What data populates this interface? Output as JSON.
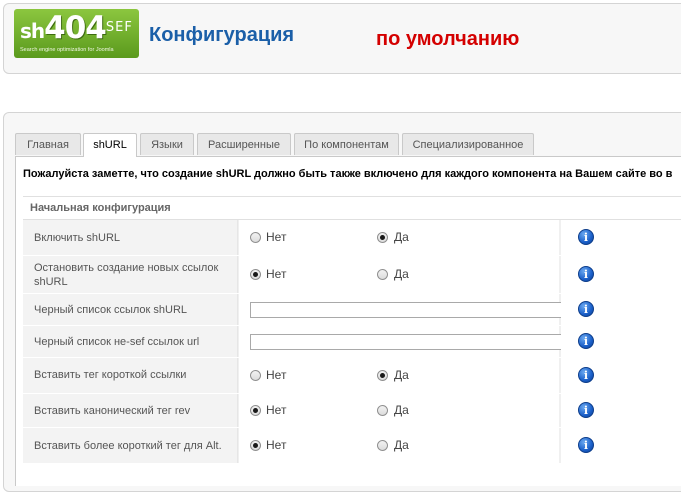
{
  "header": {
    "logo_sh": "sh",
    "logo_num": "404",
    "logo_sef": "SEF",
    "logo_tagline": "Search engine optimization for Joomla",
    "title": "Конфигурация",
    "default_label": "по умолчанию"
  },
  "tabs": [
    {
      "label": "Главная",
      "active": false
    },
    {
      "label": "shURL",
      "active": true
    },
    {
      "label": "Языки",
      "active": false
    },
    {
      "label": "Расширенные",
      "active": false
    },
    {
      "label": "По компонентам",
      "active": false
    },
    {
      "label": "Специализированное",
      "active": false
    }
  ],
  "notice": "Пожалуйста заметте, что создание shURL должно быть также включено для каждого компонента на Вашем сайте во в",
  "section_title": "Начальная конфигурация",
  "options": {
    "no": "Нет",
    "yes": "Да"
  },
  "rows": [
    {
      "label": "Включить shURL",
      "type": "radio",
      "value": "yes"
    },
    {
      "label": "Остановить создание новых ссылок shURL",
      "type": "radio",
      "value": "no"
    },
    {
      "label": "Черный список ссылок shURL",
      "type": "text",
      "value": ""
    },
    {
      "label": "Черный список не-sef ссылок url",
      "type": "text",
      "value": ""
    },
    {
      "label": "Вставить тег короткой ссылки",
      "type": "radio",
      "value": "yes"
    },
    {
      "label": "Вставить канонический тег rev",
      "type": "radio",
      "value": "no"
    },
    {
      "label": "Вставить более короткий тег для Alt.",
      "type": "radio",
      "value": "no"
    }
  ],
  "info_icon": "info-icon",
  "info_glyph": "i"
}
